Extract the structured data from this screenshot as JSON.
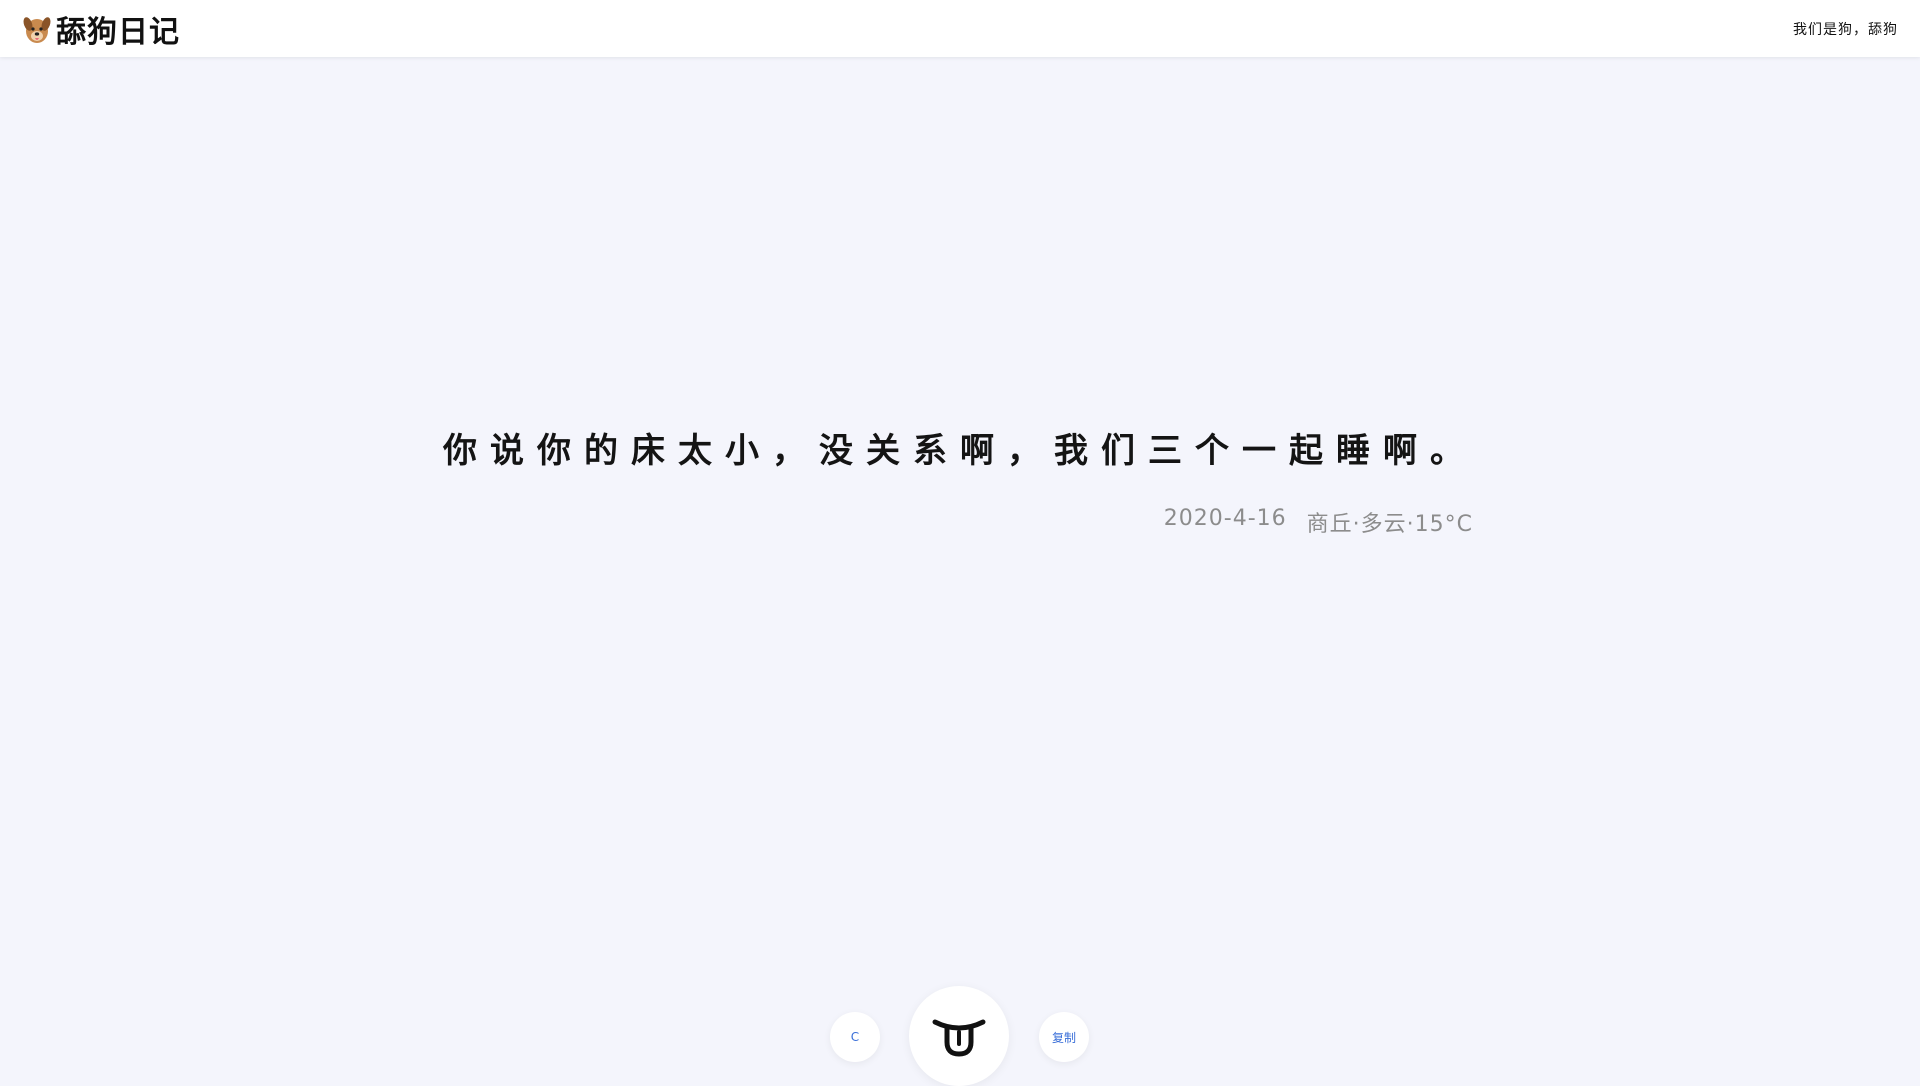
{
  "header": {
    "title": "舔狗日记",
    "slogan": "我们是狗，舔狗",
    "logo_icon": "dog-avatar-icon"
  },
  "diary": {
    "quote": "你说你的床太小，没关系啊，我们三个一起睡啊。",
    "date": "2020-4-16",
    "weather": "商丘·多云·15°C"
  },
  "controls": {
    "refresh_label": "C",
    "copy_label": "复制",
    "lick_icon": "tongue-face-icon"
  },
  "colors": {
    "background": "#f4f5fc",
    "header_bg": "#ffffff",
    "accent": "#3a6fd8",
    "meta_text": "#8c8c8c"
  }
}
